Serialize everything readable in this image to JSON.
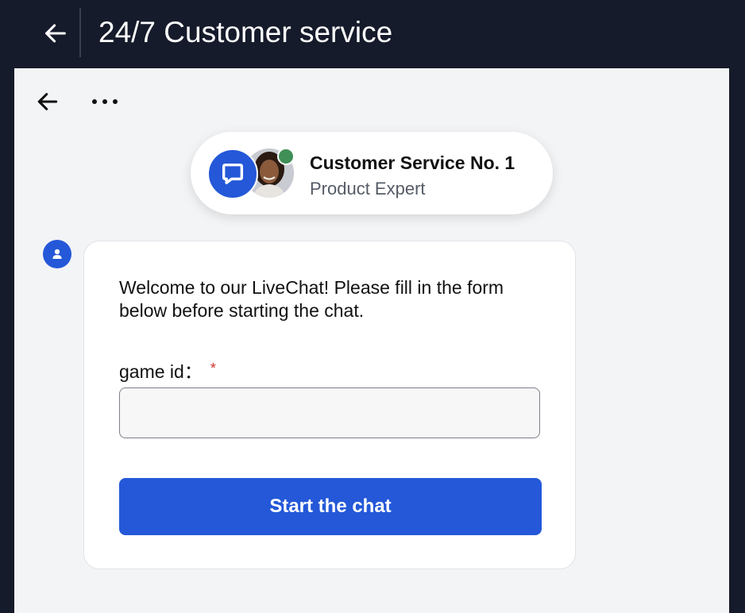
{
  "header": {
    "title": "24/7 Customer service",
    "back_icon": "arrow-left-icon"
  },
  "panel": {
    "back_icon": "arrow-left-icon",
    "more_icon": "more-horizontal-icon"
  },
  "agent": {
    "name": "Customer Service No. 1",
    "role": "Product Expert",
    "status": "online",
    "status_color": "#3f8f56",
    "logo_icon": "chat-bubble-icon"
  },
  "chat": {
    "bot_icon": "user-icon",
    "welcome_message": "Welcome to our LiveChat! Please fill in the form below before starting the chat.",
    "form": {
      "field_label": "game id：",
      "required_marker": "*",
      "field_value": "",
      "field_placeholder": ""
    },
    "start_button_label": "Start the chat"
  },
  "colors": {
    "header_bg": "#161b2b",
    "panel_bg": "#f3f4f6",
    "accent": "#2458d8",
    "required": "#d0312d"
  }
}
